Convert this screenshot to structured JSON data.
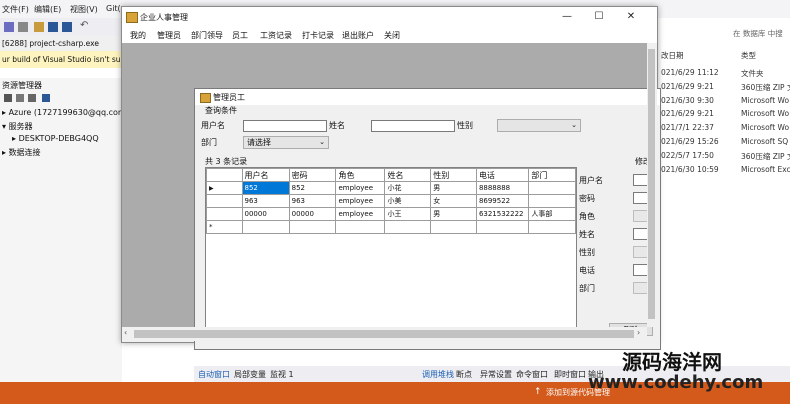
{
  "vs": {
    "menu": [
      "文件(F)",
      "编辑(E)",
      "视图(V)",
      "Git("
    ],
    "tab_title": "[6288] project-csharp.exe",
    "warning": "ur build of Visual Studio isn't supp",
    "explorer_title": "资源管理器",
    "tree": [
      "Azure (1727199630@qq.com - 0",
      "服务器",
      "DESKTOP-DEBG4QQ",
      "数据连接"
    ],
    "bottom_tabs": [
      "自动窗口",
      "局部变量",
      "监视 1",
      "调用堆栈",
      "断点",
      "异常设置",
      "命令窗口",
      "即时窗口",
      "输出"
    ],
    "status_add": "添加到源代码管理",
    "search_hint": "在 数据库 中搜",
    "files_header": {
      "date": "改日期",
      "type": "类型"
    },
    "files": [
      {
        "date": "021/6/29 11:12",
        "type": "文件夹"
      },
      {
        "date": "021/6/29 9:21",
        "type": "360压缩 ZIP 文"
      },
      {
        "date": "021/6/30 9:30",
        "type": "Microsoft Wo"
      },
      {
        "date": "021/6/29 9:21",
        "type": "Microsoft Wo"
      },
      {
        "date": "021/7/1 22:37",
        "type": "Microsoft Wo"
      },
      {
        "date": "021/6/29 15:26",
        "type": "Microsoft SQ"
      },
      {
        "date": "022/5/7 17:50",
        "type": "360压缩 ZIP 文"
      },
      {
        "date": "021/6/30 10:59",
        "type": "Microsoft Exc"
      }
    ]
  },
  "main_window": {
    "title": "企业人事管理",
    "menu": [
      "我的",
      "管理员",
      "部门领导",
      "员工",
      "工资记录",
      "打卡记录",
      "退出账户",
      "关闭"
    ]
  },
  "child_window": {
    "title": "管理员工",
    "query_group": "查询条件",
    "labels": {
      "username": "用户名",
      "name": "姓名",
      "gender": "性别",
      "dept": "部门"
    },
    "dept_select": "请选择",
    "gender_select": "",
    "record_count": "共 3 条记录",
    "edit_hint": "修改",
    "columns": [
      "用户名",
      "密码",
      "角色",
      "姓名",
      "性别",
      "电话",
      "部门"
    ],
    "rows": [
      [
        "852",
        "852",
        "employee",
        "小花",
        "男",
        "8888888",
        ""
      ],
      [
        "963",
        "963",
        "employee",
        "小美",
        "女",
        "8699522",
        ""
      ],
      [
        "00000",
        "00000",
        "employee",
        "小王",
        "男",
        "6321532222",
        "人事部"
      ]
    ],
    "new_row_marker": "*",
    "current_row_marker": "▶",
    "form_labels": [
      "用户名",
      "密码",
      "角色",
      "姓名",
      "性别",
      "电话",
      "部门"
    ],
    "delete_button": "删除"
  },
  "watermark": {
    "line1": "源码海洋网",
    "line2": "www.codehy.com"
  }
}
